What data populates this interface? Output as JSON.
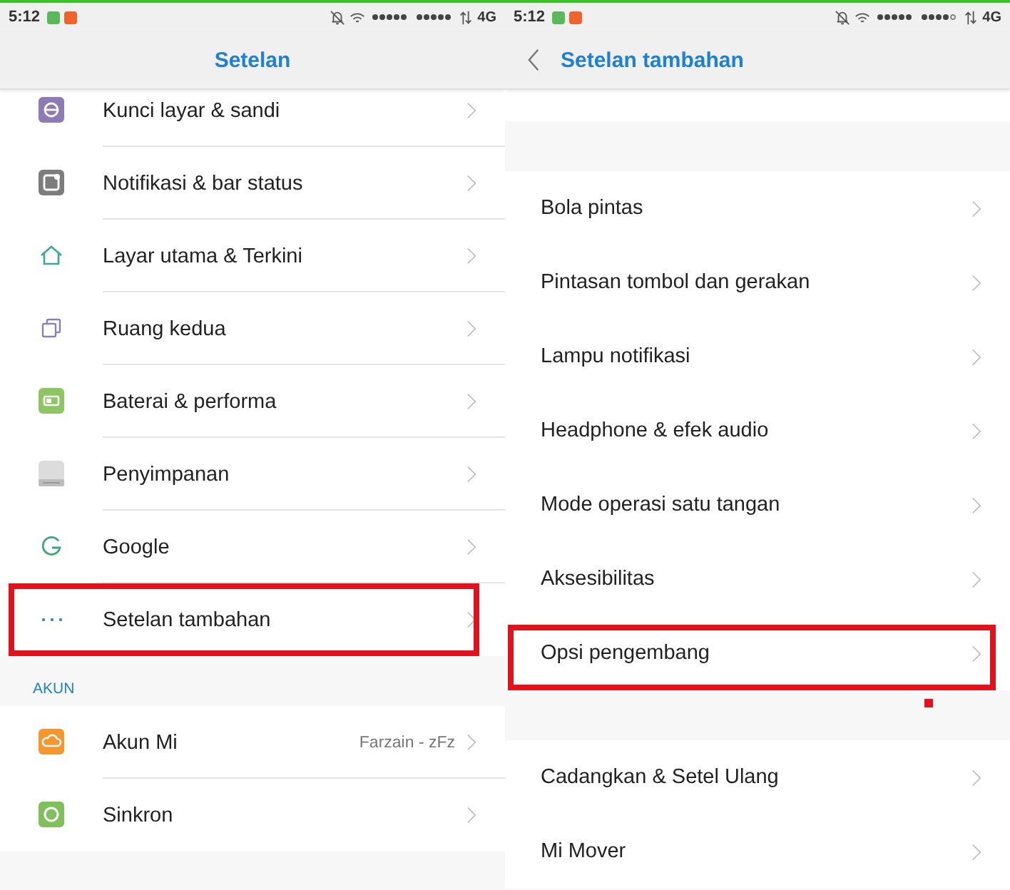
{
  "screens": [
    {
      "status_bar": {
        "time": "5:12",
        "network": "4G"
      },
      "header": {
        "title": "Setelan",
        "back": false
      },
      "sections": [
        {
          "items": [
            {
              "label": "Kunci layar & sandi",
              "kind": "lock",
              "highlighted": false
            },
            {
              "label": "Notifikasi & bar status",
              "kind": "notification",
              "highlighted": false
            },
            {
              "label": "Layar utama & Terkini",
              "kind": "home",
              "highlighted": false
            },
            {
              "label": "Ruang kedua",
              "kind": "copy",
              "highlighted": false
            },
            {
              "label": "Baterai & performa",
              "kind": "battery",
              "highlighted": false
            },
            {
              "label": "Penyimpanan",
              "kind": "storage",
              "highlighted": false
            },
            {
              "label": "Google",
              "kind": "google",
              "highlighted": false
            },
            {
              "label": "Setelan tambahan",
              "kind": "more",
              "highlighted": true
            }
          ]
        },
        {
          "label": "AKUN",
          "items": [
            {
              "label": "Akun Mi",
              "value": "Farzain - zFz",
              "kind": "cloud",
              "highlighted": false
            },
            {
              "label": "Sinkron",
              "kind": "sync",
              "highlighted": false
            }
          ]
        }
      ]
    },
    {
      "status_bar": {
        "time": "5:12",
        "network": "4G"
      },
      "header": {
        "title": "Setelan tambahan",
        "back": true
      },
      "sections": [
        {
          "items": [
            {
              "label": "Bola pintas",
              "highlighted": false
            },
            {
              "label": "Pintasan tombol dan gerakan",
              "highlighted": false
            },
            {
              "label": "Lampu notifikasi",
              "highlighted": false
            },
            {
              "label": "Headphone & efek audio",
              "highlighted": false
            },
            {
              "label": "Mode operasi satu tangan",
              "highlighted": false
            },
            {
              "label": "Aksesibilitas",
              "highlighted": false
            },
            {
              "label": "Opsi pengembang",
              "highlighted": true
            }
          ]
        },
        {
          "items": [
            {
              "label": "Cadangkan & Setel Ulang",
              "highlighted": false
            },
            {
              "label": "Mi Mover",
              "highlighted": false
            }
          ]
        }
      ]
    }
  ]
}
